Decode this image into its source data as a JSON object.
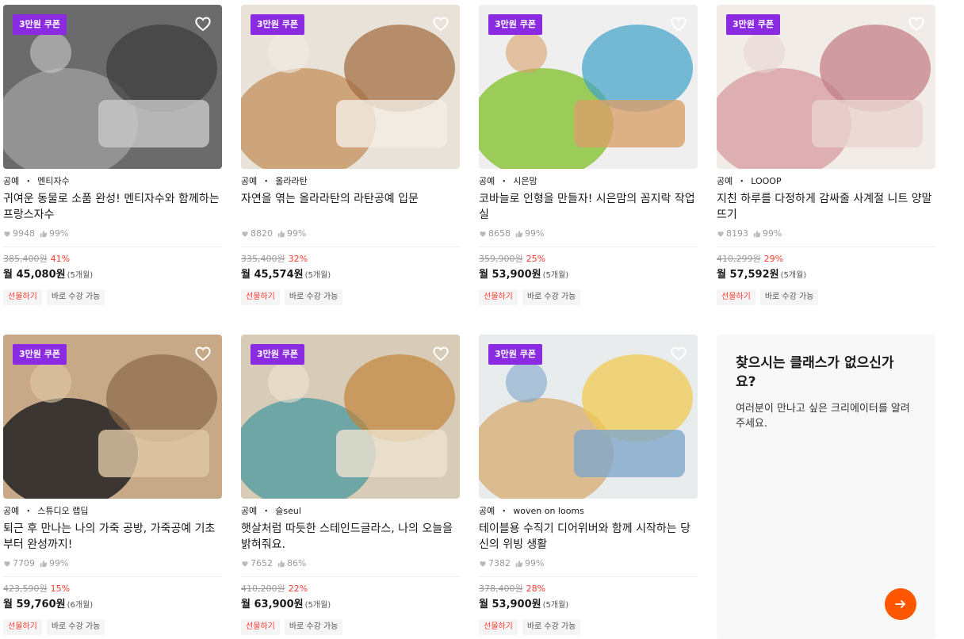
{
  "cards": [
    {
      "coupon": "3만원 쿠폰",
      "category": "공예",
      "creator": "멘티자수",
      "title": "귀여운 동물로 소품 완성! 멘티자수와 함께하는 프랑스자수",
      "likes": "9948",
      "rating": "99%",
      "original_price": "385,400원",
      "discount": "41%",
      "monthly_price": "월 45,080원",
      "installment": "(5개월)",
      "tag_gift": "선물하기",
      "tag_now": "바로 수강 가능"
    },
    {
      "coupon": "3만원 쿠폰",
      "category": "공예",
      "creator": "올라라탄",
      "title": "자연을 엮는 올라라탄의 라탄공예 입문",
      "likes": "8820",
      "rating": "99%",
      "original_price": "335,400원",
      "discount": "32%",
      "monthly_price": "월 45,574원",
      "installment": "(5개월)",
      "tag_gift": "선물하기",
      "tag_now": "바로 수강 가능"
    },
    {
      "coupon": "3만원 쿠폰",
      "category": "공예",
      "creator": "시은맘",
      "title": "코바늘로 인형을 만들자! 시은맘의 꼼지락 작업실",
      "likes": "8658",
      "rating": "99%",
      "original_price": "359,900원",
      "discount": "25%",
      "monthly_price": "월 53,900원",
      "installment": "(5개월)",
      "tag_gift": "선물하기",
      "tag_now": "바로 수강 가능"
    },
    {
      "coupon": "3만원 쿠폰",
      "category": "공예",
      "creator": "LOOOP",
      "title": "지친 하루를 다정하게 감싸줄 사계절 니트 양말 뜨기",
      "likes": "8193",
      "rating": "99%",
      "original_price": "410,299원",
      "discount": "29%",
      "monthly_price": "월 57,592원",
      "installment": "(5개월)",
      "tag_gift": "선물하기",
      "tag_now": "바로 수강 가능"
    },
    {
      "coupon": "3만원 쿠폰",
      "category": "공예",
      "creator": "스튜디오 랩딥",
      "title": "퇴근 후 만나는 나의 가죽 공방, 가죽공예 기초부터 완성까지!",
      "likes": "7709",
      "rating": "99%",
      "original_price": "423,590원",
      "discount": "15%",
      "monthly_price": "월 59,760원",
      "installment": "(6개월)",
      "tag_gift": "선물하기",
      "tag_now": "바로 수강 가능"
    },
    {
      "coupon": "3만원 쿠폰",
      "category": "공예",
      "creator": "슬seul",
      "title": "햇살처럼 따듯한 스테인드글라스, 나의 오늘을 밝혀줘요.",
      "likes": "7652",
      "rating": "86%",
      "original_price": "410,200원",
      "discount": "22%",
      "monthly_price": "월 63,900원",
      "installment": "(5개월)",
      "tag_gift": "선물하기",
      "tag_now": "바로 수강 가능"
    },
    {
      "coupon": "3만원 쿠폰",
      "category": "공예",
      "creator": "woven on looms",
      "title": "테이블용 수직기 디어위버와 함께 시작하는 당신의 위빙 생활",
      "likes": "7382",
      "rating": "99%",
      "original_price": "378,400원",
      "discount": "28%",
      "monthly_price": "월 53,900원",
      "installment": "(5개월)",
      "tag_gift": "선물하기",
      "tag_now": "바로 수강 가능"
    }
  ],
  "promo": {
    "title": "찾으시는 클래스가 없으신가요?",
    "description": "여러분이 만나고 싶은 크리에이터를 알려주세요."
  },
  "colors": {
    "coupon": "#8a2be2",
    "discount": "#ff3b30",
    "arrow_button": "#ff5600"
  }
}
